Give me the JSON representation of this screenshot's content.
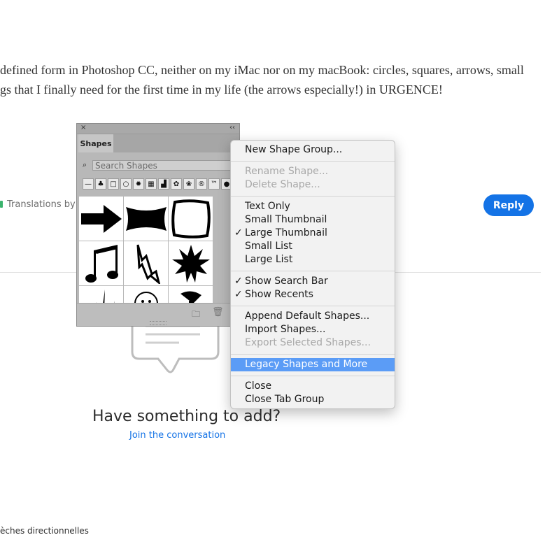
{
  "post": {
    "line1": "defined form in Photoshop CC, neither on my iMac nor on my macBook: circles, squares, arrows, small",
    "line2": "gs that I finally need for the first time in my life (the arrows especially!) in URGENCE!",
    "translations": "Translations by M",
    "reply_label": "Reply"
  },
  "panel": {
    "close": "×",
    "collapse": "‹‹",
    "tab_label": "Shapes",
    "search_placeholder": "Search Shapes",
    "recents": [
      "—",
      "♣",
      "□",
      "○",
      "✹",
      "▦",
      "▟",
      "✿",
      "❀",
      "®",
      "™",
      "●"
    ],
    "shapes": [
      "arrow-shape",
      "banner-shape",
      "frame-shape",
      "music-notes-shape",
      "lightning-shape",
      "starburst-shape",
      "grass-shape",
      "face-shape",
      "pin-shape"
    ]
  },
  "menu": {
    "items": [
      {
        "label": "New Shape Group...",
        "check": "",
        "state": "normal"
      },
      {
        "label": "Rename Shape...",
        "check": "",
        "state": "disabled"
      },
      {
        "label": "Delete Shape...",
        "check": "",
        "state": "disabled"
      },
      {
        "label": "Text Only",
        "check": "",
        "state": "normal"
      },
      {
        "label": "Small Thumbnail",
        "check": "",
        "state": "normal"
      },
      {
        "label": "Large Thumbnail",
        "check": "✓",
        "state": "normal"
      },
      {
        "label": "Small List",
        "check": "",
        "state": "normal"
      },
      {
        "label": "Large List",
        "check": "",
        "state": "normal"
      },
      {
        "label": "Show Search Bar",
        "check": "✓",
        "state": "normal"
      },
      {
        "label": "Show Recents",
        "check": "✓",
        "state": "normal"
      },
      {
        "label": "Append Default Shapes...",
        "check": "",
        "state": "normal"
      },
      {
        "label": "Import Shapes...",
        "check": "",
        "state": "normal"
      },
      {
        "label": "Export Selected Shapes...",
        "check": "",
        "state": "disabled"
      },
      {
        "label": "Legacy Shapes and More",
        "check": "",
        "state": "selected"
      },
      {
        "label": "Close",
        "check": "",
        "state": "normal"
      },
      {
        "label": "Close Tab Group",
        "check": "",
        "state": "normal"
      }
    ]
  },
  "cta": {
    "title": "Have something to add?",
    "link": "Join the conversation"
  },
  "tags": {
    "text": "èches directionnelles"
  },
  "colors": {
    "accent": "#1473e6",
    "menu_highlight": "#5b9cf6"
  }
}
